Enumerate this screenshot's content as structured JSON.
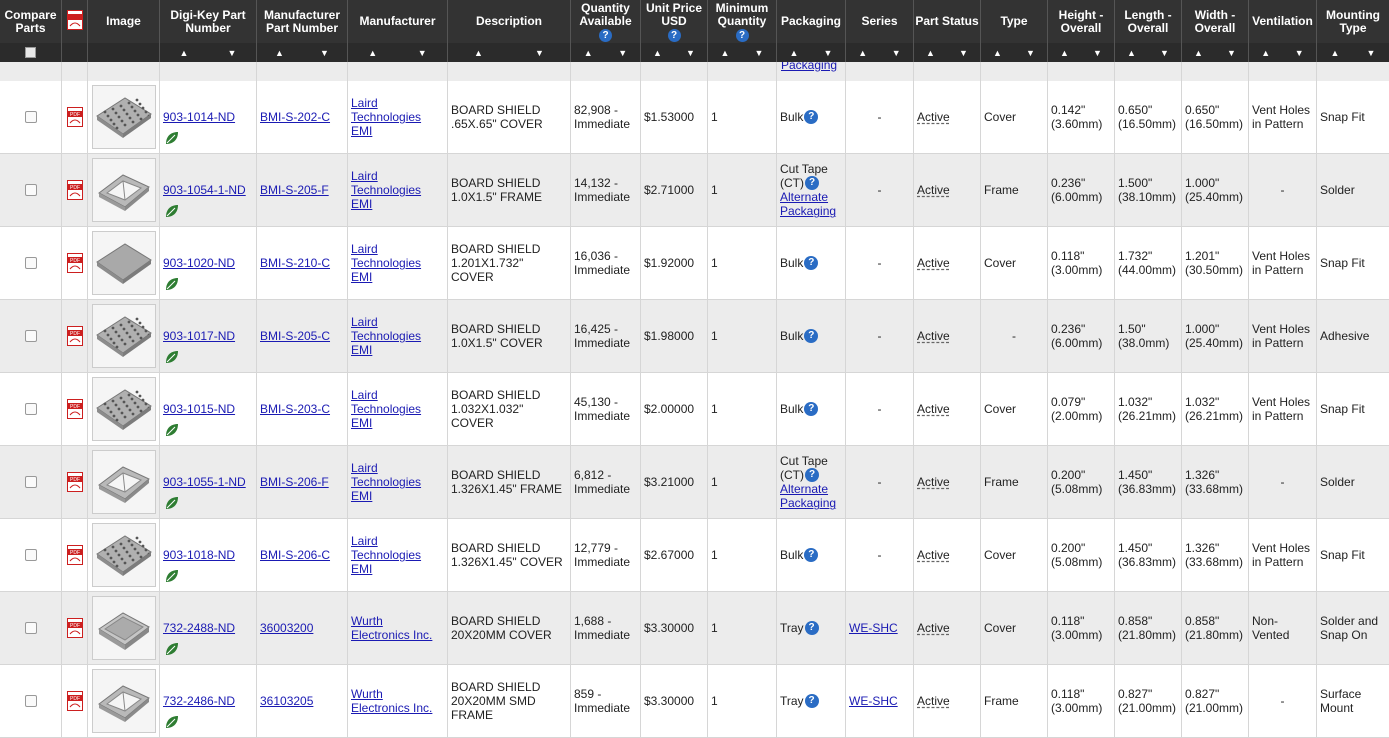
{
  "headers": [
    {
      "key": "compare",
      "label": "Compare Parts",
      "w": 62
    },
    {
      "key": "pdf",
      "label": "",
      "w": 26
    },
    {
      "key": "image",
      "label": "Image",
      "w": 72
    },
    {
      "key": "dk",
      "label": "Digi-Key Part Number",
      "w": 97
    },
    {
      "key": "mfrpn",
      "label": "Manufacturer Part Number",
      "w": 91
    },
    {
      "key": "mfr",
      "label": "Manufacturer",
      "w": 100
    },
    {
      "key": "desc",
      "label": "Description",
      "w": 123
    },
    {
      "key": "qty",
      "label": "Quantity Available",
      "w": 70,
      "help": true
    },
    {
      "key": "price",
      "label": "Unit Price USD",
      "w": 67,
      "help": true
    },
    {
      "key": "minq",
      "label": "Minimum Quantity",
      "w": 69,
      "help": true
    },
    {
      "key": "pack",
      "label": "Packaging",
      "w": 69
    },
    {
      "key": "series",
      "label": "Series",
      "w": 68
    },
    {
      "key": "status",
      "label": "Part Status",
      "w": 67
    },
    {
      "key": "type",
      "label": "Type",
      "w": 67
    },
    {
      "key": "height",
      "label": "Height - Overall",
      "w": 67
    },
    {
      "key": "length",
      "label": "Length - Overall",
      "w": 67
    },
    {
      "key": "width",
      "label": "Width - Overall",
      "w": 67
    },
    {
      "key": "vent",
      "label": "Ventilation",
      "w": 68
    },
    {
      "key": "mount",
      "label": "Mounting Type",
      "w": 73
    }
  ],
  "partial_row": {
    "packaging_link": "Packaging"
  },
  "rows": [
    {
      "dk": "903-1014-ND",
      "mfrpn": "BMI-S-202-C",
      "mfr": "Laird Technologies EMI",
      "desc": "BOARD SHIELD .65X.65\" COVER",
      "qty": "82,908 - Immediate",
      "price": "$1.53000",
      "minq": "1",
      "pack": "Bulk",
      "pack_link": "",
      "series": "-",
      "status": "Active",
      "type": "Cover",
      "height": "0.142\" (3.60mm)",
      "length": "0.650\" (16.50mm)",
      "width": "0.650\" (16.50mm)",
      "vent": "Vent Holes in Pattern",
      "mount": "Snap Fit",
      "img": "cover-holes"
    },
    {
      "dk": "903-1054-1-ND",
      "mfrpn": "BMI-S-205-F",
      "mfr": "Laird Technologies EMI",
      "desc": "BOARD SHIELD 1.0X1.5\" FRAME",
      "qty": "14,132 - Immediate",
      "price": "$2.71000",
      "minq": "1",
      "pack": "Cut Tape (CT)",
      "pack_link": "Alternate Packaging",
      "series": "-",
      "status": "Active",
      "type": "Frame",
      "height": "0.236\" (6.00mm)",
      "length": "1.500\" (38.10mm)",
      "width": "1.000\" (25.40mm)",
      "vent": "-",
      "mount": "Solder",
      "img": "frame"
    },
    {
      "dk": "903-1020-ND",
      "mfrpn": "BMI-S-210-C",
      "mfr": "Laird Technologies EMI",
      "desc": "BOARD SHIELD 1.201X1.732\" COVER",
      "qty": "16,036 - Immediate",
      "price": "$1.92000",
      "minq": "1",
      "pack": "Bulk",
      "pack_link": "",
      "series": "-",
      "status": "Active",
      "type": "Cover",
      "height": "0.118\" (3.00mm)",
      "length": "1.732\" (44.00mm)",
      "width": "1.201\" (30.50mm)",
      "vent": "Vent Holes in Pattern",
      "mount": "Snap Fit",
      "img": "cover-plain"
    },
    {
      "dk": "903-1017-ND",
      "mfrpn": "BMI-S-205-C",
      "mfr": "Laird Technologies EMI",
      "desc": "BOARD SHIELD 1.0X1.5\" COVER",
      "qty": "16,425 - Immediate",
      "price": "$1.98000",
      "minq": "1",
      "pack": "Bulk",
      "pack_link": "",
      "series": "-",
      "status": "Active",
      "type": "-",
      "height": "0.236\" (6.00mm)",
      "length": "1.50\" (38.0mm)",
      "width": "1.000\" (25.40mm)",
      "vent": "Vent Holes in Pattern",
      "mount": "Adhesive",
      "img": "cover-holes"
    },
    {
      "dk": "903-1015-ND",
      "mfrpn": "BMI-S-203-C",
      "mfr": "Laird Technologies EMI",
      "desc": "BOARD SHIELD 1.032X1.032\" COVER",
      "qty": "45,130 - Immediate",
      "price": "$2.00000",
      "minq": "1",
      "pack": "Bulk",
      "pack_link": "",
      "series": "-",
      "status": "Active",
      "type": "Cover",
      "height": "0.079\" (2.00mm)",
      "length": "1.032\" (26.21mm)",
      "width": "1.032\" (26.21mm)",
      "vent": "Vent Holes in Pattern",
      "mount": "Snap Fit",
      "img": "cover-holes"
    },
    {
      "dk": "903-1055-1-ND",
      "mfrpn": "BMI-S-206-F",
      "mfr": "Laird Technologies EMI",
      "desc": "BOARD SHIELD 1.326X1.45\" FRAME",
      "qty": "6,812 - Immediate",
      "price": "$3.21000",
      "minq": "1",
      "pack": "Cut Tape (CT)",
      "pack_link": "Alternate Packaging",
      "series": "-",
      "status": "Active",
      "type": "Frame",
      "height": "0.200\" (5.08mm)",
      "length": "1.450\" (36.83mm)",
      "width": "1.326\" (33.68mm)",
      "vent": "-",
      "mount": "Solder",
      "img": "frame"
    },
    {
      "dk": "903-1018-ND",
      "mfrpn": "BMI-S-206-C",
      "mfr": "Laird Technologies EMI",
      "desc": "BOARD SHIELD 1.326X1.45\" COVER",
      "qty": "12,779 - Immediate",
      "price": "$2.67000",
      "minq": "1",
      "pack": "Bulk",
      "pack_link": "",
      "series": "-",
      "status": "Active",
      "type": "Cover",
      "height": "0.200\" (5.08mm)",
      "length": "1.450\" (36.83mm)",
      "width": "1.326\" (33.68mm)",
      "vent": "Vent Holes in Pattern",
      "mount": "Snap Fit",
      "img": "cover-holes"
    },
    {
      "dk": "732-2488-ND",
      "mfrpn": "36003200",
      "mfr": "Wurth Electronics Inc.",
      "desc": "BOARD SHIELD 20X20MM COVER",
      "qty": "1,688 - Immediate",
      "price": "$3.30000",
      "minq": "1",
      "pack": "Tray",
      "pack_link": "",
      "series": "WE-SHC",
      "status": "Active",
      "type": "Cover",
      "height": "0.118\" (3.00mm)",
      "length": "0.858\" (21.80mm)",
      "width": "0.858\" (21.80mm)",
      "vent": "Non-Vented",
      "mount": "Solder and Snap On",
      "img": "tray"
    },
    {
      "dk": "732-2486-ND",
      "mfrpn": "36103205",
      "mfr": "Wurth Electronics Inc.",
      "desc": "BOARD SHIELD 20X20MM SMD FRAME",
      "qty": "859 - Immediate",
      "price": "$3.30000",
      "minq": "1",
      "pack": "Tray",
      "pack_link": "",
      "series": "WE-SHC",
      "status": "Active",
      "type": "Frame",
      "height": "0.118\" (3.00mm)",
      "length": "0.827\" (21.00mm)",
      "width": "0.827\" (21.00mm)",
      "vent": "-",
      "mount": "Surface Mount",
      "img": "frame"
    }
  ],
  "colors": {
    "header_bg": "#333333",
    "link": "#1a1ab3",
    "row_alt": "#ececec",
    "help_icon": "#2a6cc4",
    "pdf_red": "#cc1f1f",
    "leaf_green": "#2e7d32"
  },
  "icons": {
    "pdf": "pdf-icon",
    "rohs": "leaf-icon",
    "help": "help-icon",
    "sort_up": "sort-ascending-icon",
    "sort_down": "sort-descending-icon"
  }
}
